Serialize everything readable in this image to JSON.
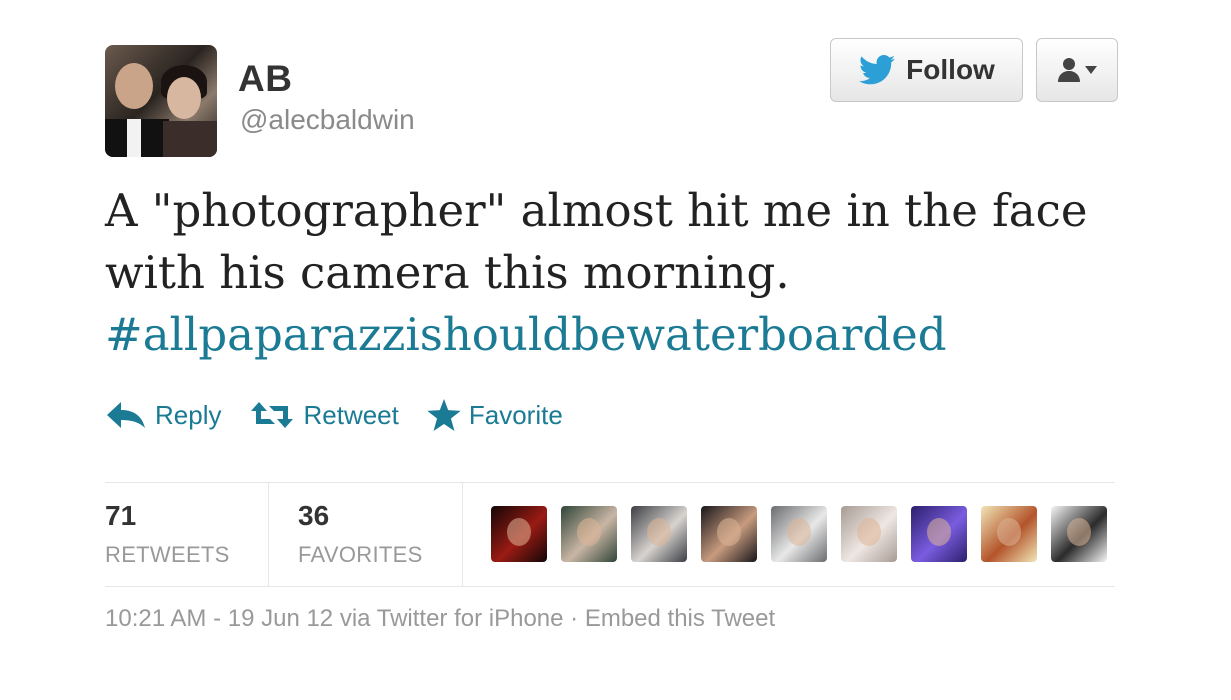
{
  "user": {
    "name": "AB",
    "handle": "@alecbaldwin",
    "avatar_icon": "profile-photo"
  },
  "buttons": {
    "follow_label": "Follow",
    "follow_icon": "twitter-bird-icon",
    "user_menu_icon": "user-dropdown-icon"
  },
  "tweet": {
    "line1": "A \"photographer\" almost hit me in the face",
    "line2": "with his camera this morning.",
    "hashtag": "#allpaparazzishouldbewaterboarded"
  },
  "actions": {
    "reply": "Reply",
    "retweet": "Retweet",
    "favorite": "Favorite"
  },
  "stats": {
    "retweets_count": "71",
    "retweets_label": "RETWEETS",
    "favorites_count": "36",
    "favorites_label": "FAVORITES"
  },
  "favoriters": [
    {
      "color_a": "#120606",
      "color_b": "#9a1b14"
    },
    {
      "color_a": "#2f4538",
      "color_b": "#c9b6a5"
    },
    {
      "color_a": "#3c3e44",
      "color_b": "#d7d3cf"
    },
    {
      "color_a": "#18161a",
      "color_b": "#c79b7f"
    },
    {
      "color_a": "#6a6c6e",
      "color_b": "#e8e8e8"
    },
    {
      "color_a": "#a79b94",
      "color_b": "#efe7e3"
    },
    {
      "color_a": "#2b1f6b",
      "color_b": "#7a5de0"
    },
    {
      "color_a": "#f1e6b7",
      "color_b": "#b3542b"
    },
    {
      "color_a": "#f6f6f6",
      "color_b": "#2b2b2b"
    }
  ],
  "meta": {
    "timestamp": "10:21 AM - 19 Jun 12 via Twitter for iPhone",
    "separator": "·",
    "embed_link": "Embed this Tweet"
  },
  "colors": {
    "link": "#1b7b95",
    "text": "#222222",
    "muted": "#999999"
  }
}
